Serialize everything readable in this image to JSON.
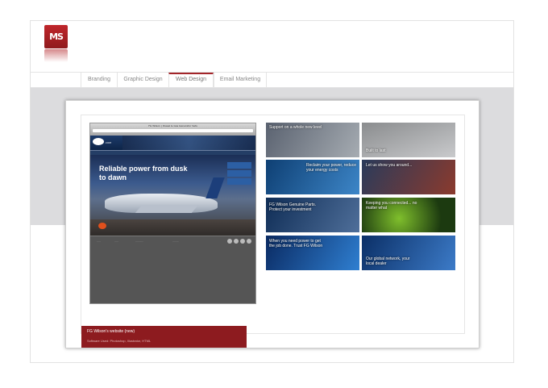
{
  "logo": {
    "text": "MS",
    "reflection_text": ""
  },
  "nav": {
    "tabs": [
      {
        "label": "Branding",
        "active": false
      },
      {
        "label": "Graphic Design",
        "active": false
      },
      {
        "label": "Web Design",
        "active": true
      },
      {
        "label": "Email Marketing",
        "active": false
      }
    ]
  },
  "project": {
    "title": "FG Wilson's website (new)",
    "software": "Software Used: Photoshop, Illustrator, HTML"
  },
  "screenshot_site": {
    "window_title": "FG Wilson | Diesel & Gas Generator Sets",
    "domain_suffix": ".COM",
    "headline": "Reliable power from dusk to dawn"
  },
  "tiles": [
    {
      "caption": "Support on a whole new level",
      "colors": [
        "#5a6270",
        "#a6acb2"
      ]
    },
    {
      "caption": "Built to last",
      "colors": [
        "#8a8c8e",
        "#c9cacc"
      ]
    },
    {
      "caption": "Reclaim your power, reduce your energy costs",
      "colors": [
        "#0e3f73",
        "#3d86c8"
      ]
    },
    {
      "caption": "Let us show you around...",
      "colors": [
        "#2a3b5b",
        "#8b3a2d"
      ]
    },
    {
      "caption": "FG Wilson Genuine Parts. Protect your investment",
      "colors": [
        "#0f2d56",
        "#4f6f9a"
      ]
    },
    {
      "caption": "Keeping you connected... no matter what",
      "colors": [
        "#1c3a10",
        "#7fbf2c"
      ]
    },
    {
      "caption": "When you need power to get the job done. Trust FG Wilson",
      "colors": [
        "#0a2a62",
        "#2f7fd1"
      ]
    },
    {
      "caption": "Our global network, your local dealer",
      "colors": [
        "#0b2f66",
        "#3c7bc8"
      ]
    }
  ],
  "colors": {
    "accent": "#a3252a",
    "caption_bg": "#8d1b1f",
    "band": "#dcdcde"
  }
}
